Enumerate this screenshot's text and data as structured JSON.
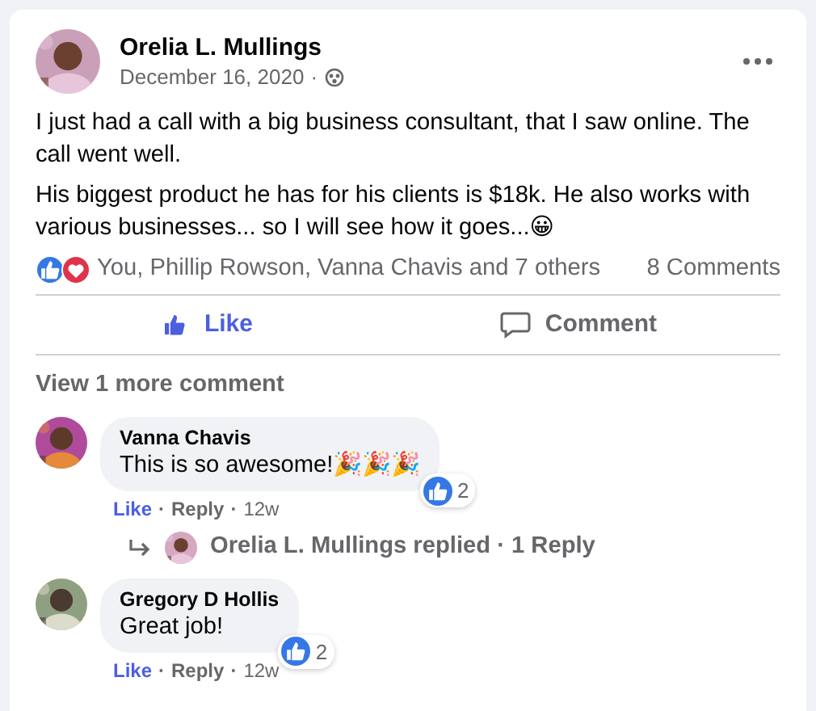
{
  "post": {
    "author": "Orelia L. Mullings",
    "date": "December 16, 2020",
    "separator": "·",
    "paragraphs": [
      "I just had a call with a big business consultant, that I saw online. The call went well.",
      "His biggest product he has for his clients is $18k. He also works with various businesses... so I will see how it goes...😀"
    ],
    "reactions": {
      "summary": "You, Phillip Rowson, Vanna Chavis and 7 others",
      "comments_count": "8 Comments"
    },
    "actions": [
      {
        "kind": "like",
        "label": "Like",
        "selected": true
      },
      {
        "kind": "comment",
        "label": "Comment",
        "selected": false
      }
    ]
  },
  "comments": {
    "more_link": "View 1 more comment",
    "separator": "·",
    "items": [
      {
        "author": "Vanna Chavis",
        "text": "This is so awesome!🎉🎉🎉",
        "reaction_count": "2",
        "liked": true,
        "like": "Like",
        "reply": "Reply",
        "time": "12w",
        "replies_summary": "Orelia L. Mullings replied · 1 Reply"
      },
      {
        "author": "Gregory D Hollis",
        "text": "Great job!",
        "reaction_count": "2",
        "liked": true,
        "like": "Like",
        "reply": "Reply",
        "time": "12w"
      }
    ]
  }
}
